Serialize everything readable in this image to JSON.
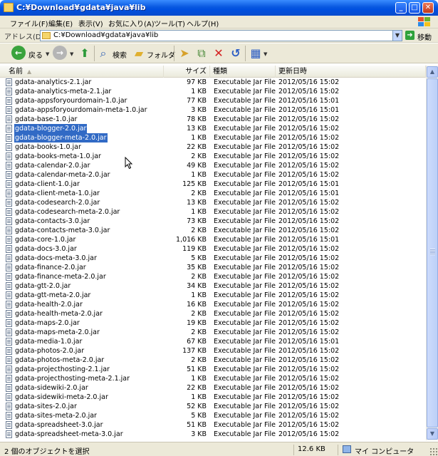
{
  "window": {
    "title": "C:¥Download¥gdata¥java¥lib",
    "buttons": {
      "minimize": "_",
      "maximize": "□",
      "close": "✕"
    }
  },
  "menu": [
    "ファイル(F)",
    "編集(E)",
    "表示(V)",
    "お気に入り(A)",
    "ツール(T)",
    "ヘルプ(H)"
  ],
  "address": {
    "label": "アドレス(D)",
    "value": "C:¥Download¥gdata¥java¥lib",
    "go_label": "移動"
  },
  "toolbar": {
    "back_label": "戻る",
    "search_label": "検索",
    "folders_label": "フォルダ"
  },
  "columns": {
    "name": "名前",
    "size": "サイズ",
    "type": "種類",
    "date": "更新日時"
  },
  "files": [
    {
      "name": "gdata-analytics-2.1.jar",
      "size": "97 KB",
      "type": "Executable Jar File",
      "date": "2012/05/16 15:02"
    },
    {
      "name": "gdata-analytics-meta-2.1.jar",
      "size": "1 KB",
      "type": "Executable Jar File",
      "date": "2012/05/16 15:02"
    },
    {
      "name": "gdata-appsforyourdomain-1.0.jar",
      "size": "77 KB",
      "type": "Executable Jar File",
      "date": "2012/05/16 15:01"
    },
    {
      "name": "gdata-appsforyourdomain-meta-1.0.jar",
      "size": "3 KB",
      "type": "Executable Jar File",
      "date": "2012/05/16 15:01"
    },
    {
      "name": "gdata-base-1.0.jar",
      "size": "78 KB",
      "type": "Executable Jar File",
      "date": "2012/05/16 15:02"
    },
    {
      "name": "gdata-blogger-2.0.jar",
      "size": "13 KB",
      "type": "Executable Jar File",
      "date": "2012/05/16 15:02",
      "selected": true
    },
    {
      "name": "gdata-blogger-meta-2.0.jar",
      "size": "1 KB",
      "type": "Executable Jar File",
      "date": "2012/05/16 15:02",
      "selected": true
    },
    {
      "name": "gdata-books-1.0.jar",
      "size": "22 KB",
      "type": "Executable Jar File",
      "date": "2012/05/16 15:02"
    },
    {
      "name": "gdata-books-meta-1.0.jar",
      "size": "2 KB",
      "type": "Executable Jar File",
      "date": "2012/05/16 15:02"
    },
    {
      "name": "gdata-calendar-2.0.jar",
      "size": "49 KB",
      "type": "Executable Jar File",
      "date": "2012/05/16 15:02"
    },
    {
      "name": "gdata-calendar-meta-2.0.jar",
      "size": "1 KB",
      "type": "Executable Jar File",
      "date": "2012/05/16 15:02"
    },
    {
      "name": "gdata-client-1.0.jar",
      "size": "125 KB",
      "type": "Executable Jar File",
      "date": "2012/05/16 15:01"
    },
    {
      "name": "gdata-client-meta-1.0.jar",
      "size": "2 KB",
      "type": "Executable Jar File",
      "date": "2012/05/16 15:01"
    },
    {
      "name": "gdata-codesearch-2.0.jar",
      "size": "13 KB",
      "type": "Executable Jar File",
      "date": "2012/05/16 15:02"
    },
    {
      "name": "gdata-codesearch-meta-2.0.jar",
      "size": "1 KB",
      "type": "Executable Jar File",
      "date": "2012/05/16 15:02"
    },
    {
      "name": "gdata-contacts-3.0.jar",
      "size": "73 KB",
      "type": "Executable Jar File",
      "date": "2012/05/16 15:02"
    },
    {
      "name": "gdata-contacts-meta-3.0.jar",
      "size": "2 KB",
      "type": "Executable Jar File",
      "date": "2012/05/16 15:02"
    },
    {
      "name": "gdata-core-1.0.jar",
      "size": "1,016 KB",
      "type": "Executable Jar File",
      "date": "2012/05/16 15:01"
    },
    {
      "name": "gdata-docs-3.0.jar",
      "size": "119 KB",
      "type": "Executable Jar File",
      "date": "2012/05/16 15:02"
    },
    {
      "name": "gdata-docs-meta-3.0.jar",
      "size": "5 KB",
      "type": "Executable Jar File",
      "date": "2012/05/16 15:02"
    },
    {
      "name": "gdata-finance-2.0.jar",
      "size": "35 KB",
      "type": "Executable Jar File",
      "date": "2012/05/16 15:02"
    },
    {
      "name": "gdata-finance-meta-2.0.jar",
      "size": "2 KB",
      "type": "Executable Jar File",
      "date": "2012/05/16 15:02"
    },
    {
      "name": "gdata-gtt-2.0.jar",
      "size": "34 KB",
      "type": "Executable Jar File",
      "date": "2012/05/16 15:02"
    },
    {
      "name": "gdata-gtt-meta-2.0.jar",
      "size": "1 KB",
      "type": "Executable Jar File",
      "date": "2012/05/16 15:02"
    },
    {
      "name": "gdata-health-2.0.jar",
      "size": "16 KB",
      "type": "Executable Jar File",
      "date": "2012/05/16 15:02"
    },
    {
      "name": "gdata-health-meta-2.0.jar",
      "size": "2 KB",
      "type": "Executable Jar File",
      "date": "2012/05/16 15:02"
    },
    {
      "name": "gdata-maps-2.0.jar",
      "size": "19 KB",
      "type": "Executable Jar File",
      "date": "2012/05/16 15:02"
    },
    {
      "name": "gdata-maps-meta-2.0.jar",
      "size": "2 KB",
      "type": "Executable Jar File",
      "date": "2012/05/16 15:02"
    },
    {
      "name": "gdata-media-1.0.jar",
      "size": "67 KB",
      "type": "Executable Jar File",
      "date": "2012/05/16 15:01"
    },
    {
      "name": "gdata-photos-2.0.jar",
      "size": "137 KB",
      "type": "Executable Jar File",
      "date": "2012/05/16 15:02"
    },
    {
      "name": "gdata-photos-meta-2.0.jar",
      "size": "2 KB",
      "type": "Executable Jar File",
      "date": "2012/05/16 15:02"
    },
    {
      "name": "gdata-projecthosting-2.1.jar",
      "size": "51 KB",
      "type": "Executable Jar File",
      "date": "2012/05/16 15:02"
    },
    {
      "name": "gdata-projecthosting-meta-2.1.jar",
      "size": "1 KB",
      "type": "Executable Jar File",
      "date": "2012/05/16 15:02"
    },
    {
      "name": "gdata-sidewiki-2.0.jar",
      "size": "22 KB",
      "type": "Executable Jar File",
      "date": "2012/05/16 15:02"
    },
    {
      "name": "gdata-sidewiki-meta-2.0.jar",
      "size": "1 KB",
      "type": "Executable Jar File",
      "date": "2012/05/16 15:02"
    },
    {
      "name": "gdata-sites-2.0.jar",
      "size": "52 KB",
      "type": "Executable Jar File",
      "date": "2012/05/16 15:02"
    },
    {
      "name": "gdata-sites-meta-2.0.jar",
      "size": "5 KB",
      "type": "Executable Jar File",
      "date": "2012/05/16 15:02"
    },
    {
      "name": "gdata-spreadsheet-3.0.jar",
      "size": "51 KB",
      "type": "Executable Jar File",
      "date": "2012/05/16 15:02"
    },
    {
      "name": "gdata-spreadsheet-meta-3.0.jar",
      "size": "3 KB",
      "type": "Executable Jar File",
      "date": "2012/05/16 15:02"
    }
  ],
  "status": {
    "selection": "2 個のオブジェクトを選択",
    "size": "12.6 KB",
    "location": "マイ コンピュータ"
  },
  "colors": {
    "title_bar": "#0858e0",
    "selection": "#316ac5",
    "chrome": "#ece9d8"
  }
}
